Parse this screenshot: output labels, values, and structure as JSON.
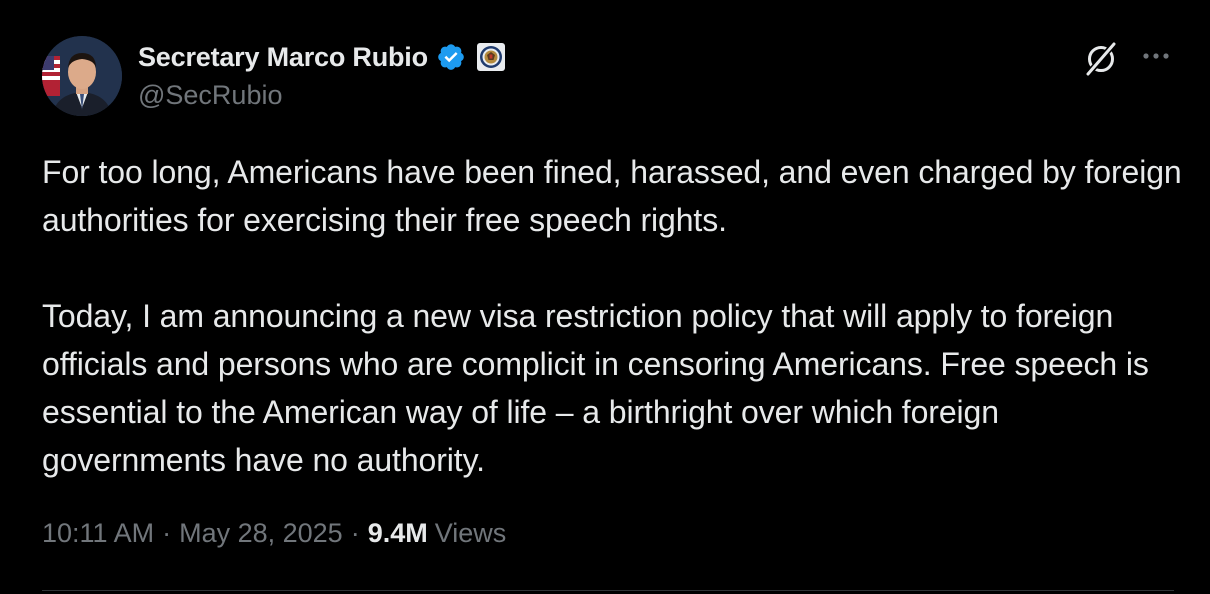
{
  "author": {
    "display_name": "Secretary Marco Rubio",
    "handle": "@SecRubio",
    "verified": true,
    "avatar_icon": "profile-photo",
    "affiliation_icon": "state-department-seal-icon"
  },
  "tweet": {
    "paragraphs": [
      "For too long, Americans have been fined, harassed, and even charged by foreign authorities for exercising their free speech rights.",
      "Today, I am announcing a new visa restriction policy that will apply to foreign officials and persons who are complicit in censoring Americans. Free speech is essential to the American way of life – a birthright over which foreign governments have no authority."
    ],
    "time": "10:11 AM",
    "date": "May 28, 2025",
    "views_count": "9.4M",
    "views_label": "Views",
    "separator": "·"
  },
  "actions": {
    "grok_icon": "grok-icon",
    "more_icon": "more-dots-icon"
  },
  "colors": {
    "background": "#000000",
    "text_primary": "#e7e9ea",
    "text_secondary": "#71767b",
    "verified": "#1d9bf0",
    "divider": "#2f3336"
  }
}
